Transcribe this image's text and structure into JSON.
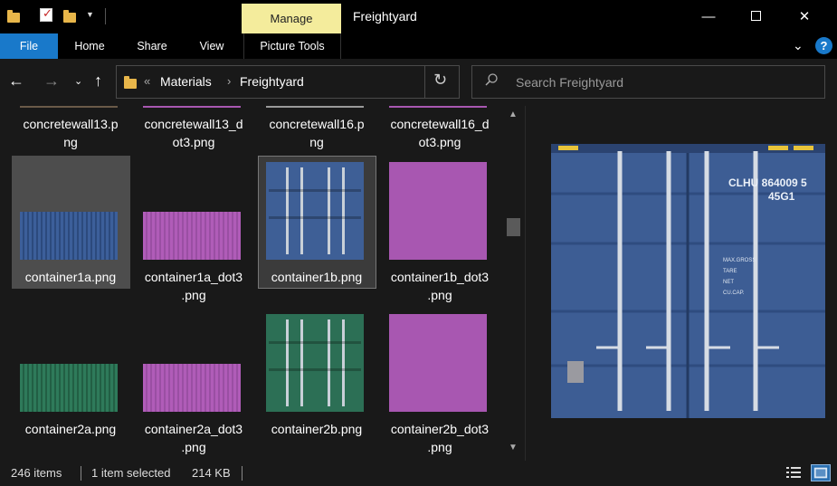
{
  "window": {
    "title": "Freightyard",
    "manage_tab": "Manage",
    "minimize": "—",
    "close": "✕"
  },
  "ribbon": {
    "tabs": [
      "File",
      "Home",
      "Share",
      "View",
      "Picture Tools"
    ],
    "expand": "⌄",
    "help": "?"
  },
  "nav": {
    "back": "←",
    "forward": "→",
    "recent": "⌄",
    "up": "↑",
    "chevron": "«",
    "breadcrumb": [
      "Materials",
      "Freightyard"
    ],
    "separator": "›",
    "refresh": "↻"
  },
  "search": {
    "placeholder": "Search Freightyard"
  },
  "files": [
    {
      "name": "concretewall13.p\nng"
    },
    {
      "name": "concretewall13_d\not3.png"
    },
    {
      "name": "concretewall16.p\nng"
    },
    {
      "name": "concretewall16_d\not3.png"
    },
    {
      "name": "container1a.png"
    },
    {
      "name": "container1a_dot3\n.png"
    },
    {
      "name": "container1b.png"
    },
    {
      "name": "container1b_dot3\n.png"
    },
    {
      "name": "container2a.png"
    },
    {
      "name": "container2a_dot3\n.png"
    },
    {
      "name": "container2b.png"
    },
    {
      "name": "container2b_dot3\n.png"
    }
  ],
  "preview": {
    "code": "CLHU  864009 5",
    "subcode": "45G1",
    "weights": [
      "MAX.GROSS",
      "TARE",
      "NET",
      "CU.CAP."
    ]
  },
  "scrollbar": {
    "up": "▲",
    "down": "▼"
  },
  "status": {
    "count": "246 items",
    "selected": "1 item selected",
    "size": "214 KB"
  },
  "colors": {
    "accent": "#1979ca",
    "manage": "#f4ec9c",
    "selected": "#4d4d4d"
  }
}
